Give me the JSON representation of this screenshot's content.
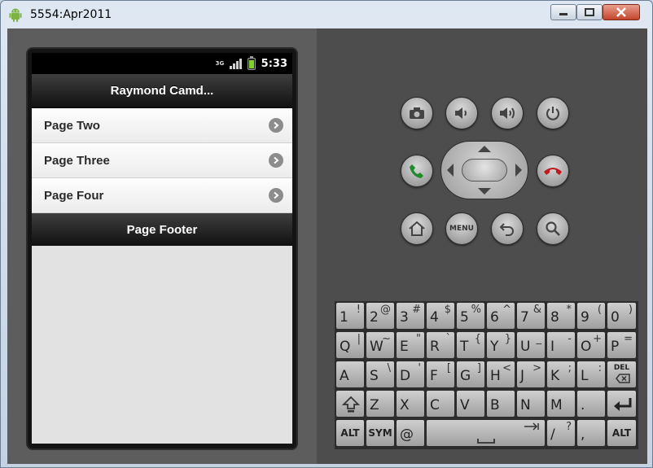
{
  "window": {
    "title": "5554:Apr2011"
  },
  "status_bar": {
    "network": "3G",
    "time": "5:33",
    "battery_level": 0.75
  },
  "app": {
    "header_title": "Raymond Camd...",
    "list_items": [
      {
        "label": "Page Two"
      },
      {
        "label": "Page Three"
      },
      {
        "label": "Page Four"
      }
    ],
    "footer_title": "Page Footer"
  },
  "hardware_buttons": {
    "menu_label": "MENU",
    "icons": [
      "camera-icon",
      "volume-down-icon",
      "volume-up-icon",
      "power-icon",
      "call-icon",
      "end-call-icon",
      "home-icon",
      "menu-button",
      "back-icon",
      "search-icon"
    ]
  },
  "colors": {
    "call": "#1f8b2a",
    "end_call": "#c0181b"
  },
  "keyboard": {
    "row1": [
      [
        "1",
        "!"
      ],
      [
        "2",
        "@"
      ],
      [
        "3",
        "#"
      ],
      [
        "4",
        "$"
      ],
      [
        "5",
        "%"
      ],
      [
        "6",
        "^"
      ],
      [
        "7",
        "&"
      ],
      [
        "8",
        "*"
      ],
      [
        "9",
        "("
      ],
      [
        "0",
        ")"
      ]
    ],
    "row2": [
      [
        "Q",
        "|"
      ],
      [
        "W",
        "~"
      ],
      [
        "E",
        "\""
      ],
      [
        "R",
        "`"
      ],
      [
        "T",
        "{"
      ],
      [
        "Y",
        "}"
      ],
      [
        "U",
        "_"
      ],
      [
        "I",
        "-"
      ],
      [
        "O",
        "+"
      ],
      [
        "P",
        "="
      ]
    ],
    "row3": [
      [
        "A",
        ""
      ],
      [
        "S",
        "\\"
      ],
      [
        "D",
        "'"
      ],
      [
        "F",
        "["
      ],
      [
        "G",
        "]"
      ],
      [
        "H",
        "<"
      ],
      [
        "J",
        ">"
      ],
      [
        "K",
        ";"
      ],
      [
        "L",
        ":"
      ]
    ],
    "row3_del": "DEL",
    "row4": [
      [
        "Z",
        ""
      ],
      [
        "X",
        ""
      ],
      [
        "C",
        ""
      ],
      [
        "V",
        ""
      ],
      [
        "B",
        ""
      ],
      [
        "N",
        ""
      ],
      [
        "M",
        ""
      ],
      [
        ".",
        ""
      ]
    ],
    "row5": {
      "alt": "ALT",
      "sym": "SYM",
      "at": "@",
      "slash": "/",
      "slash_alt": "?",
      "comma": ",",
      "alt_right": "ALT"
    }
  }
}
